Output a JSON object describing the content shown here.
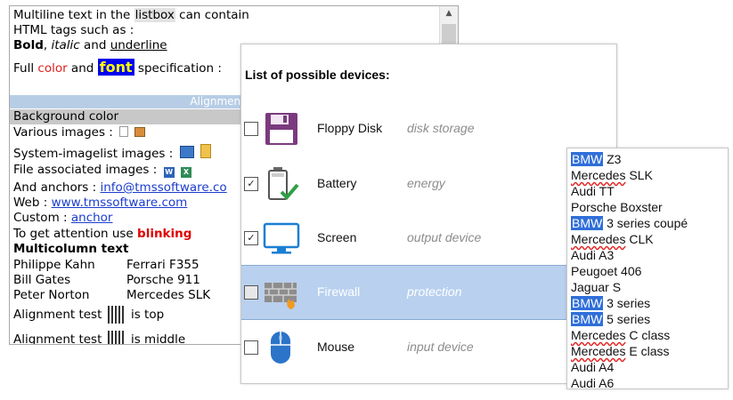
{
  "listbox1": {
    "line1_a": "Multiline text in the ",
    "line1_b": "listbox",
    "line1_c": " can contain",
    "line2": "HTML tags such as :",
    "line3_bold": "Bold",
    "line3_sep1": ", ",
    "line3_italic": "italic",
    "line3_and": " and ",
    "line3_underline": "underline",
    "line4_full": "Full ",
    "line4_color": "color",
    "line4_and": " and ",
    "line4_font": "font",
    "line4_spec": " specification :",
    "alignment_band": "Alignment can b",
    "background_color": "Background color",
    "various_images": "Various images :",
    "system_imagelist": "System-imagelist images :",
    "file_assoc": "File associated images :",
    "anchors_label": "And anchors : ",
    "anchors_link": "info@tmssoftware.co",
    "web_label": "Web : ",
    "web_link": "www.tmssoftware.com",
    "custom_label": "Custom : ",
    "custom_link": "anchor",
    "attention_label": "To get attention use ",
    "attention_blink": "blinking",
    "multicolumn_title": "Multicolumn text",
    "rows": [
      {
        "name": "Philippe Kahn",
        "car": "Ferrari F355"
      },
      {
        "name": "Bill Gates",
        "car": "Porsche 911"
      },
      {
        "name": "Peter Norton",
        "car": "Mercedes SLK"
      }
    ],
    "align_top_label": "Alignment test",
    "align_top_value": "is top",
    "align_mid_label": "Alignment test",
    "align_mid_value": "is middle"
  },
  "devices": {
    "header": "List of possible devices:",
    "items": [
      {
        "name": "Floppy Disk",
        "desc": "disk storage",
        "checked": false,
        "icon": "floppy-disk-icon"
      },
      {
        "name": "Battery",
        "desc": "energy",
        "checked": true,
        "icon": "battery-icon"
      },
      {
        "name": "Screen",
        "desc": "output device",
        "checked": true,
        "icon": "monitor-icon"
      },
      {
        "name": "Firewall",
        "desc": "protection",
        "checked": false,
        "icon": "firewall-icon",
        "selected": true
      },
      {
        "name": "Mouse",
        "desc": "input device",
        "checked": false,
        "icon": "mouse-icon"
      }
    ],
    "check_mark": "✓"
  },
  "cars": {
    "items": [
      {
        "brand": "BMW",
        "model": " Z3",
        "style": "bmw"
      },
      {
        "brand": "Mercedes",
        "model": " SLK",
        "style": "merc"
      },
      {
        "brand": "Audi",
        "model": " TT",
        "style": ""
      },
      {
        "brand": "Porsche",
        "model": " Boxster",
        "style": ""
      },
      {
        "brand": "BMW",
        "model": " 3 series coupé",
        "style": "bmw"
      },
      {
        "brand": "Mercedes",
        "model": " CLK",
        "style": "merc"
      },
      {
        "brand": "Audi",
        "model": " A3",
        "style": ""
      },
      {
        "brand": "Peugoet",
        "model": " 406",
        "style": ""
      },
      {
        "brand": "Jaguar",
        "model": " S",
        "style": ""
      },
      {
        "brand": "BMW",
        "model": " 3 series",
        "style": "bmw"
      },
      {
        "brand": "BMW",
        "model": " 5 series",
        "style": "bmw"
      },
      {
        "brand": "Mercedes",
        "model": " C class",
        "style": "merc"
      },
      {
        "brand": "Mercedes",
        "model": " E class",
        "style": "merc"
      },
      {
        "brand": "Audi",
        "model": " A4",
        "style": ""
      },
      {
        "brand": "Audi",
        "model": " A6",
        "style": ""
      }
    ]
  },
  "colors": {
    "selection": "#b9d0ee",
    "bmw_highlight": "#2f6fd8",
    "font_highlight": "#0000ee",
    "link": "#1a3ccc",
    "blink": "#e00000"
  }
}
